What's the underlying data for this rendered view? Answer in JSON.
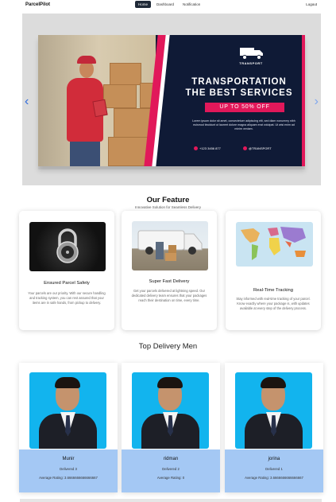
{
  "navbar": {
    "brand": "ParcelPilot",
    "links": [
      "Home",
      "Dashboard",
      "Notification"
    ],
    "active": "Home",
    "logout": "Logout"
  },
  "hero": {
    "ad_brand": "TRANSPORT",
    "ad_title_line1": "TRANSPORTATION",
    "ad_title_line2": "THE BEST SERVICES",
    "ad_offer": "UP TO 50% OFF",
    "ad_body": "Lorem ipsum dolor sit amet, consectetuer adipiscing elit, sed diam nonummy nibh euismod tincidunt ut laoreet dolore magna aliquam erat volutpat. Ut wisi enim ad minim veniam.",
    "ad_phone": "+123 3456 877",
    "ad_social": "@TRANSPORT",
    "prev_arrow": "‹",
    "next_arrow": "›"
  },
  "features": {
    "title": "Our Feature",
    "subtitle": "Innovative Solution for Seamless Delivery",
    "cards": [
      {
        "title": "Ensured Parcel Safety",
        "text": "Your parcels are our priority. With our secure handling and tracking system, you can rest assured that your items are in safe hands, from pickup to delivery."
      },
      {
        "title": "Super Fast Delivery",
        "text": "Get your parcels delivered at lightning speed. Our dedicated delivery team ensures that your packages reach their destination on time, every time."
      },
      {
        "title": "Real-Time Tracking",
        "text": "Stay informed with real-time tracking of your parcel. Know exactly where your package is, with updates available at every step of the delivery process."
      }
    ]
  },
  "delivery": {
    "title": "Top Delivery Men",
    "men": [
      {
        "name": "Munir",
        "delivered": "Delivered 3",
        "rating": "Average Rating: 3.6666666666666667"
      },
      {
        "name": "ridman",
        "delivered": "Delivered 2",
        "rating": "Average Rating: 0"
      },
      {
        "name": "jorina",
        "delivered": "Delivered 1",
        "rating": "Average Rating: 3.6666666666666667"
      }
    ]
  },
  "colors": {
    "accent": "#1f2937",
    "brand_pink": "#e1185a",
    "ad_navy": "#0f1a36",
    "info_blue": "#a4c8f4",
    "photo_bg": "#12b4ee"
  },
  "icons": [
    "chevron-left-icon",
    "chevron-right-icon",
    "truck-icon",
    "phone-icon",
    "social-icon"
  ]
}
